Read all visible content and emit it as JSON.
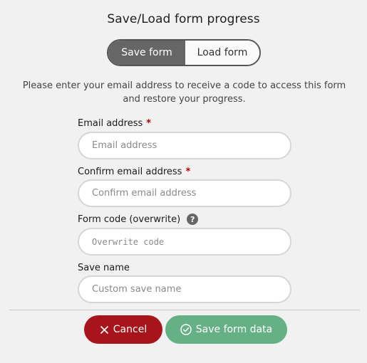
{
  "dialog": {
    "title": "Save/Load form progress",
    "toggle": {
      "save_label": "Save form",
      "load_label": "Load form",
      "active": "Save form"
    },
    "description": "Please enter your email address to receive a code to access this form and restore your progress.",
    "fields": {
      "email": {
        "label": "Email address",
        "required_marker": "*",
        "placeholder": "Email address",
        "value": ""
      },
      "confirm_email": {
        "label": "Confirm email address",
        "required_marker": "*",
        "placeholder": "Confirm email address",
        "value": ""
      },
      "form_code": {
        "label": "Form code (overwrite)",
        "help_icon": "question-circle-icon",
        "help_glyph": "?",
        "placeholder": "Overwrite code",
        "value": ""
      },
      "save_name": {
        "label": "Save name",
        "placeholder": "Custom save name",
        "value": ""
      }
    },
    "buttons": {
      "cancel_label": "Cancel",
      "cancel_icon": "x-icon",
      "save_label": "Save form data",
      "save_icon": "check-circle-icon"
    },
    "colors": {
      "toggle_active_bg": "#666666",
      "required": "#b40000",
      "cancel_bg": "#a8141c",
      "save_bg": "#66b085",
      "background": "#f1f1f1"
    }
  }
}
